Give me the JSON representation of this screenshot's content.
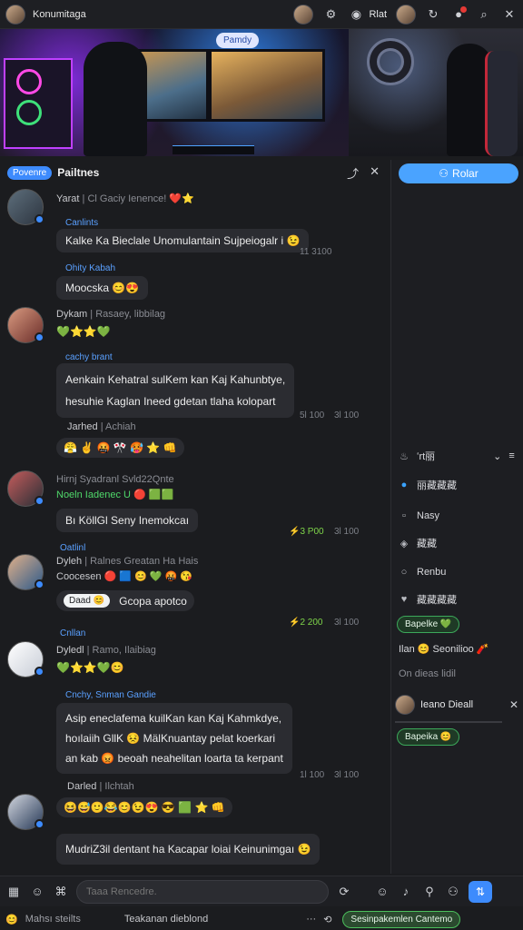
{
  "topbar": {
    "app_title": "Konumitaga",
    "user_short": "Rlat"
  },
  "hero": {
    "pill": "Pamdy"
  },
  "chat_header": {
    "tag": "Povenre",
    "title": "Pailtnes"
  },
  "messages": [
    {
      "meta": "Yarat",
      "meta_dim": "| Cl Gaciy Ienence!",
      "meta_emoji": "❤️⭐",
      "username": "Canlints",
      "bubble": "Kalke Ka Bieclale Unomulantain Sujpeiogalr i 😉",
      "time": "11 3100"
    },
    {
      "username": "Ohity Kabah",
      "bubble": "Moocska 😊😍"
    },
    {
      "meta": "Dykam",
      "meta_dim": "| Rasaey, libbilag",
      "emoji_row": "💚⭐⭐💚",
      "username": "cachy brant",
      "bubble_lines": [
        "Aenkain Kehatral sulKem kan Kaj Kahunbtye,",
        "hesuhie Kaglan Ineed gdetan tlaha kolopart"
      ],
      "time_a": "5l 100",
      "time_b": "3l 100"
    },
    {
      "meta": "Jarhed",
      "meta_dim": "| Achiah",
      "emoji_row": "😤 ✌️ 🤬 🎌 🥵 ⭐ 👊"
    },
    {
      "meta": "Hirnj Syadranl Svld22Qnte",
      "green_line": "Noeln Iadenec U 🔴 🟩🟩",
      "bubble": "Bı KöllGl Seny Inemokcaı",
      "time_a": "⚡3 P00",
      "time_b": "3l 100"
    },
    {
      "username": "Oatlinl",
      "meta": "Dyleh",
      "meta_dim": "| Ralnes Greatan Ha Hais",
      "emoji_row": "Coocesen 🔴 🟦 😊 💚 🤬 😘",
      "bubble_tag": "Daad 😊",
      "bubble": "Gcopa apotco",
      "time_a": "⚡2 200",
      "time_b": "3l 100"
    },
    {
      "username": "Cnllan",
      "meta": "Dyledl",
      "meta_dim": "| Ramo, Ilaibiag",
      "emoji_row": "💚⭐⭐💚😊",
      "username2": "Cnchy, Snman Gandie",
      "bubble_lines": [
        "Asip eneclafema kuilKan kan Kaj Kahmkdye,",
        "hoılaiih GllK 😣 MälKnuantay pelat koerkari",
        "an kab 😡 beoah neahelitan loarta ta kerpant"
      ],
      "time_a": "1l 100",
      "time_b": "3l 100"
    },
    {
      "meta": "Darled",
      "meta_dim": "| Ilchtah",
      "emoji_row": "😆😅🙂😂😊😉😍 😎 🟩 ⭐ 👊",
      "bubble": "MudriZ3il dentant ha Kacapar loiai Keinunimgaı 😉"
    }
  ],
  "sidebar": {
    "button": "Rolar",
    "section_title": "ʻrt丽",
    "rows": [
      {
        "icon": "info-icon",
        "label": "丽藏藏藏"
      },
      {
        "icon": "square-icon",
        "label": "Nasy"
      },
      {
        "icon": "sync-icon",
        "label": "藏藏"
      },
      {
        "icon": "circle-icon",
        "label": "Renbu"
      },
      {
        "icon": "heart-icon",
        "label": "藏藏藏藏"
      }
    ],
    "pill1": "Bapelke 💚",
    "row_emoji": "Ilan 😊 Seonilioo 🧨",
    "dim_row": "On dieas lidil",
    "profile_name": "Ieano Dieall",
    "pill2": "Bapeika 😊"
  },
  "composer": {
    "placeholder": "Taaa Rencedre."
  },
  "statusbar": {
    "left": "Mahsı steilts",
    "center": "Teakanan dieblond",
    "dots": "···",
    "pill": "Sesinpakemlen Cantemo"
  }
}
